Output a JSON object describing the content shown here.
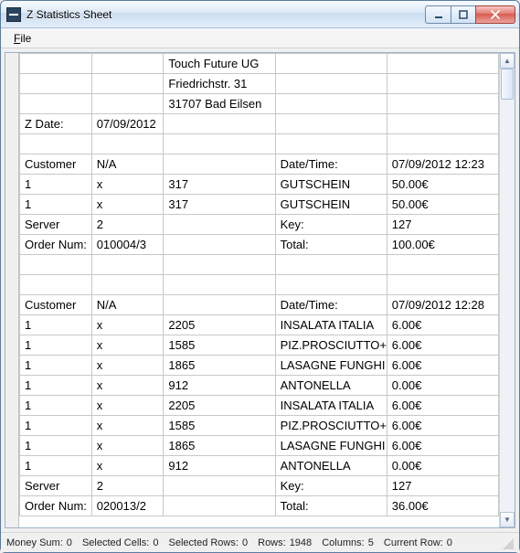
{
  "window": {
    "title": "Z Statistics Sheet"
  },
  "menu": {
    "file": "File"
  },
  "columns": [
    "",
    "",
    "",
    "",
    ""
  ],
  "rows": [
    [
      "",
      "",
      "Touch Future UG",
      "",
      ""
    ],
    [
      "",
      "",
      "Friedrichstr. 31",
      "",
      ""
    ],
    [
      "",
      "",
      "31707 Bad Eilsen",
      "",
      ""
    ],
    [
      "Z Date:",
      "07/09/2012",
      "",
      "",
      ""
    ],
    [
      "",
      "",
      "",
      "",
      ""
    ],
    [
      "Customer",
      "N/A",
      "",
      "Date/Time:",
      "07/09/2012 12:23"
    ],
    [
      "1",
      "x",
      "317",
      "GUTSCHEIN",
      "50.00€"
    ],
    [
      "1",
      "x",
      "317",
      "GUTSCHEIN",
      "50.00€"
    ],
    [
      "Server",
      "2",
      "",
      "Key:",
      "127"
    ],
    [
      "Order Num:",
      "010004/3",
      "",
      "Total:",
      "100.00€"
    ],
    [
      "",
      "",
      "",
      "",
      ""
    ],
    [
      "",
      "",
      "",
      "",
      ""
    ],
    [
      "Customer",
      "N/A",
      "",
      "Date/Time:",
      "07/09/2012 12:28"
    ],
    [
      "1",
      "x",
      "2205",
      "INSALATA ITALIA",
      "6.00€"
    ],
    [
      "1",
      "x",
      "1585",
      "PIZ.PROSCIUTTO+",
      "6.00€"
    ],
    [
      "1",
      "x",
      "1865",
      "LASAGNE FUNGHI",
      "6.00€"
    ],
    [
      "1",
      "x",
      "912",
      "ANTONELLA",
      "0.00€"
    ],
    [
      "1",
      "x",
      "2205",
      "INSALATA ITALIA",
      "6.00€"
    ],
    [
      "1",
      "x",
      "1585",
      "PIZ.PROSCIUTTO+",
      "6.00€"
    ],
    [
      "1",
      "x",
      "1865",
      "LASAGNE FUNGHI",
      "6.00€"
    ],
    [
      "1",
      "x",
      "912",
      "ANTONELLA",
      "0.00€"
    ],
    [
      "Server",
      "2",
      "",
      "Key:",
      "127"
    ],
    [
      "Order Num:",
      "020013/2",
      "",
      "Total:",
      "36.00€"
    ]
  ],
  "status": {
    "money_sum_label": "Money Sum:",
    "money_sum": "0",
    "selected_cells_label": "Selected Cells:",
    "selected_cells": "0",
    "selected_rows_label": "Selected Rows:",
    "selected_rows": "0",
    "rows_label": "Rows:",
    "rows": "1948",
    "columns_label": "Columns:",
    "columns": "5",
    "current_row_label": "Current Row:",
    "current_row": "0"
  }
}
